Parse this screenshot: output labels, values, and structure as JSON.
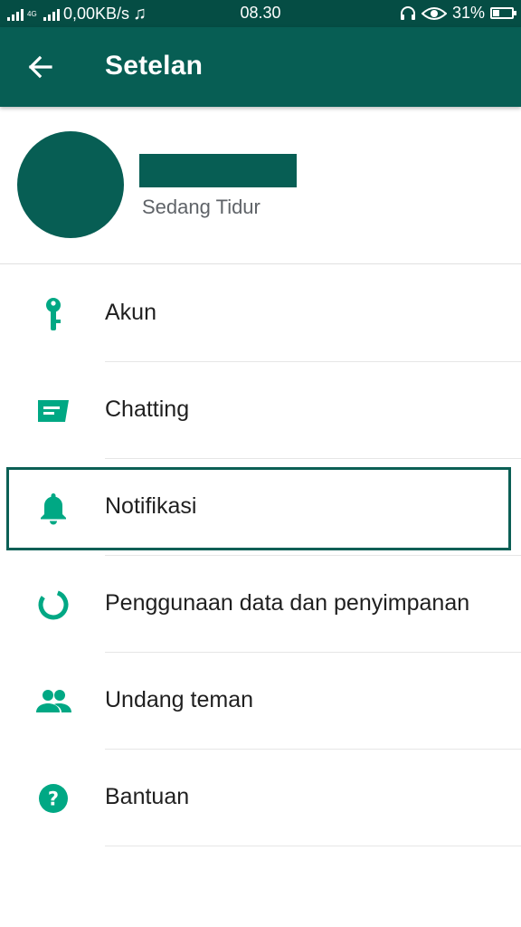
{
  "status_bar": {
    "network_speed": "0,00KB/s",
    "network_type": "4G",
    "music_icon": "music-note-icon",
    "time": "08.30",
    "headset_icon": "headset-icon",
    "eye_icon": "eye-icon",
    "battery_percent_label": "31%",
    "battery_level": 0.31
  },
  "toolbar": {
    "back_icon": "arrow-left-icon",
    "title": "Setelan"
  },
  "profile": {
    "status": "Sedang Tidur"
  },
  "menu": [
    {
      "id": "akun",
      "label": "Akun",
      "icon": "key-icon"
    },
    {
      "id": "chatting",
      "label": "Chatting",
      "icon": "chat-icon"
    },
    {
      "id": "notifikasi",
      "label": "Notifikasi",
      "icon": "bell-icon",
      "focused": true
    },
    {
      "id": "data",
      "label": "Penggunaan data dan penyimpanan",
      "icon": "data-usage-icon"
    },
    {
      "id": "undang",
      "label": "Undang teman",
      "icon": "people-icon"
    },
    {
      "id": "bantuan",
      "label": "Bantuan",
      "icon": "help-icon"
    }
  ],
  "colors": {
    "primary": "#075e54",
    "status_bar": "#054d44",
    "icon_teal": "#00a884",
    "focus_border": "#0b5f55"
  }
}
